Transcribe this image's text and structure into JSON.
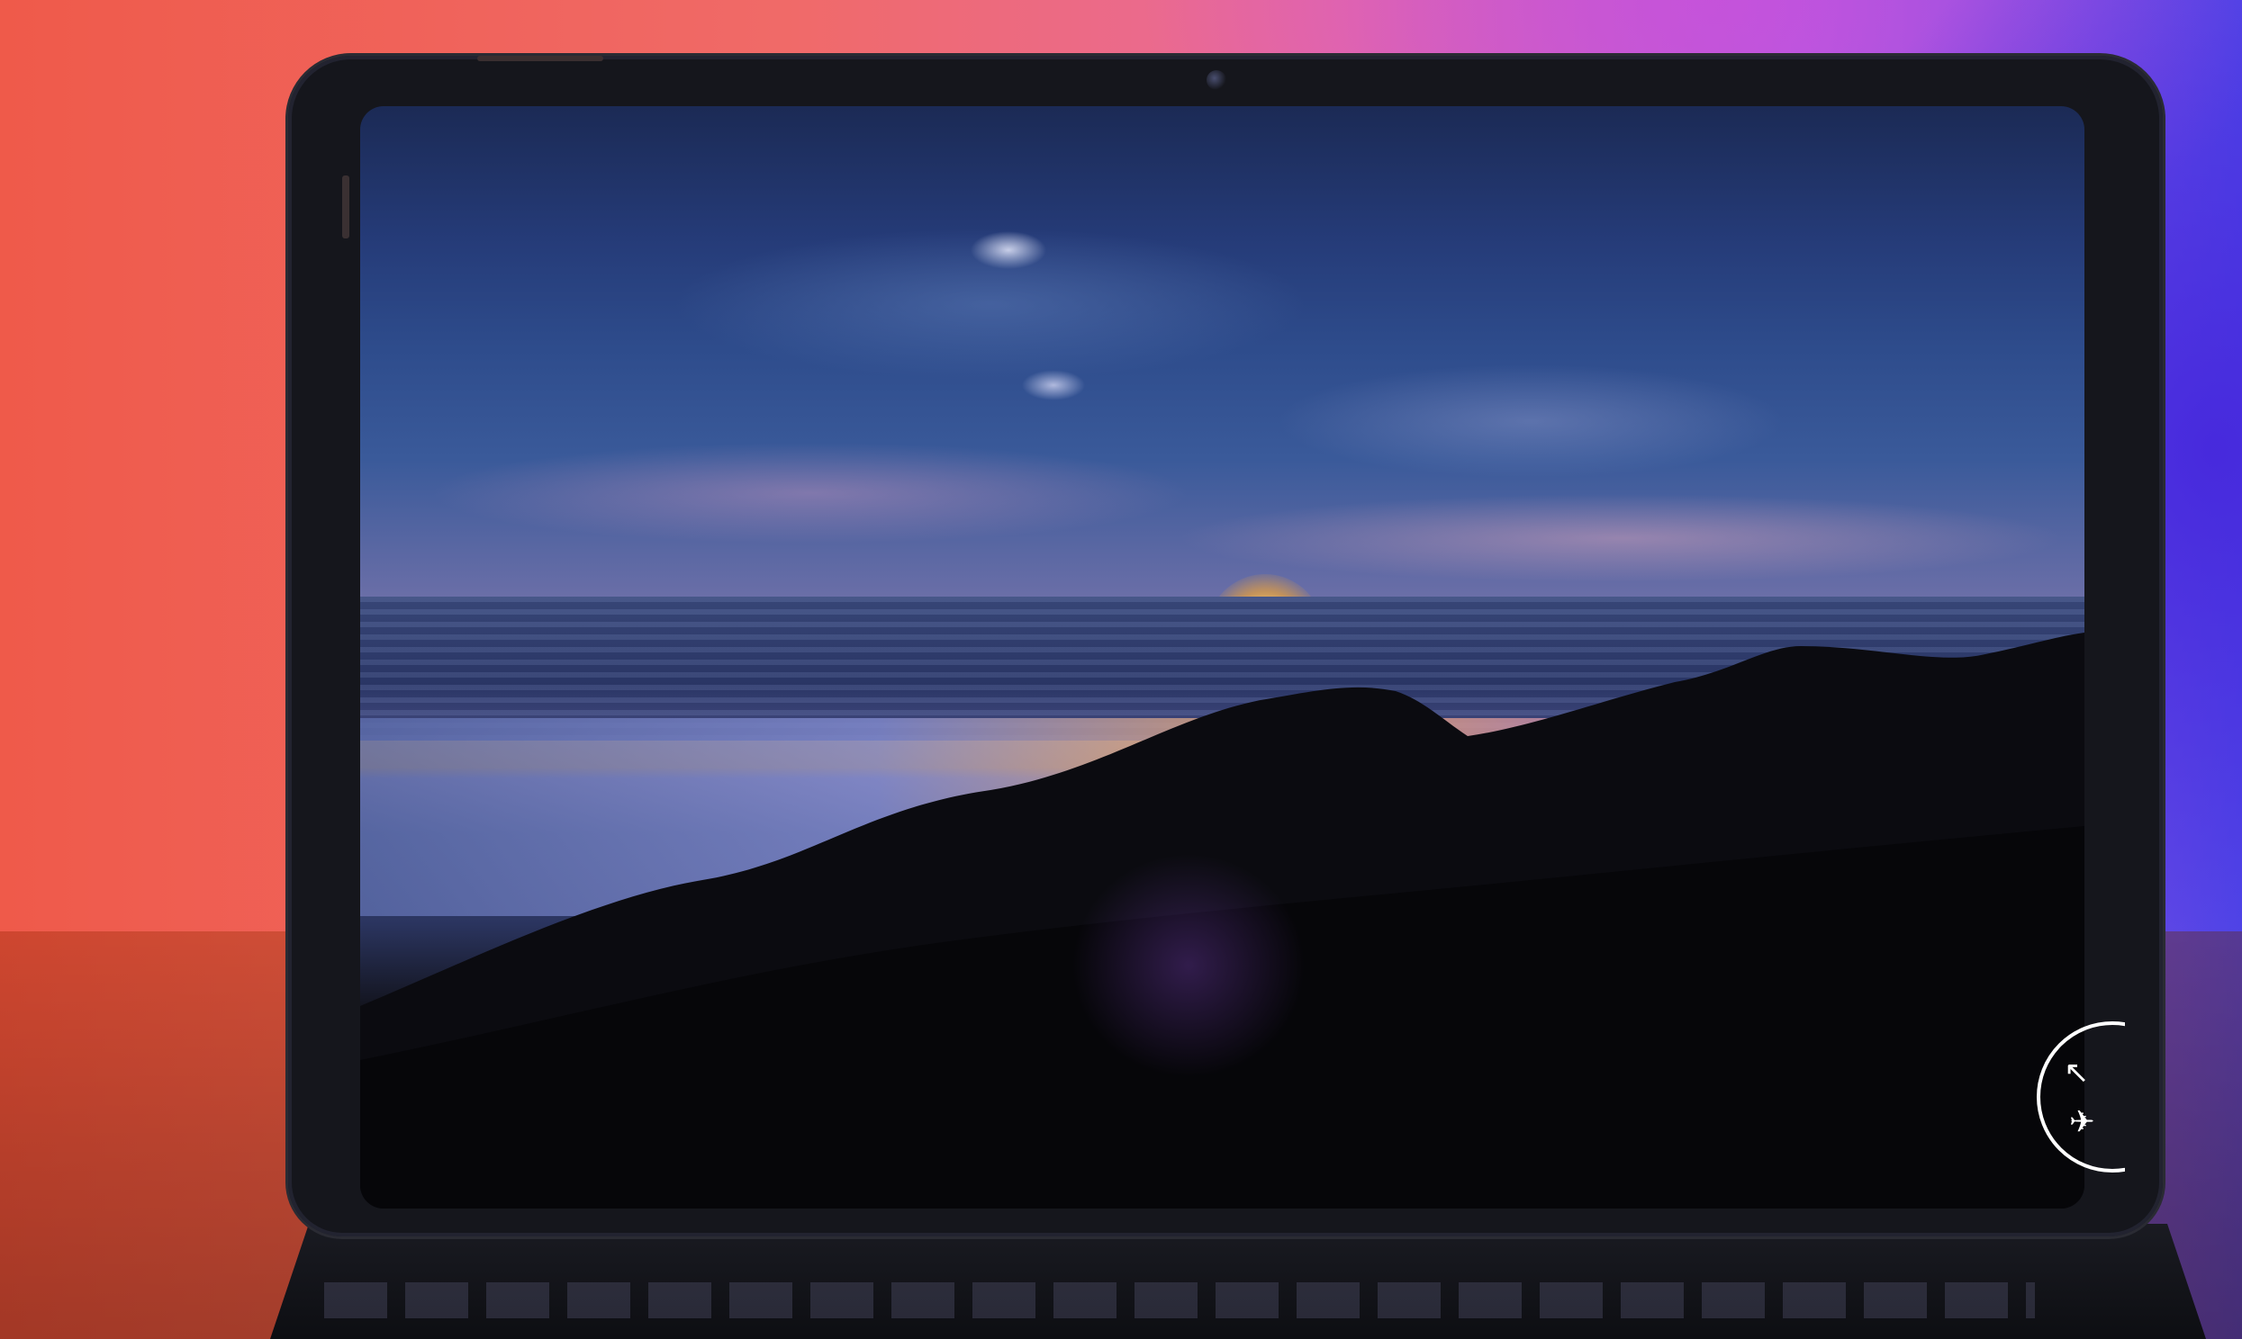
{
  "scene": {
    "subject": "",
    "screen_content": ""
  },
  "overlay": {
    "rotate_icon": "rotate-lock-icon",
    "arrow_glyph": "↖",
    "airplane_glyph": "✈"
  },
  "colors": {
    "sky_top": "#1b2a55",
    "horizon": "#f7b14a",
    "wall_left": "#ef5a4a",
    "wall_right": "#5048e8"
  }
}
